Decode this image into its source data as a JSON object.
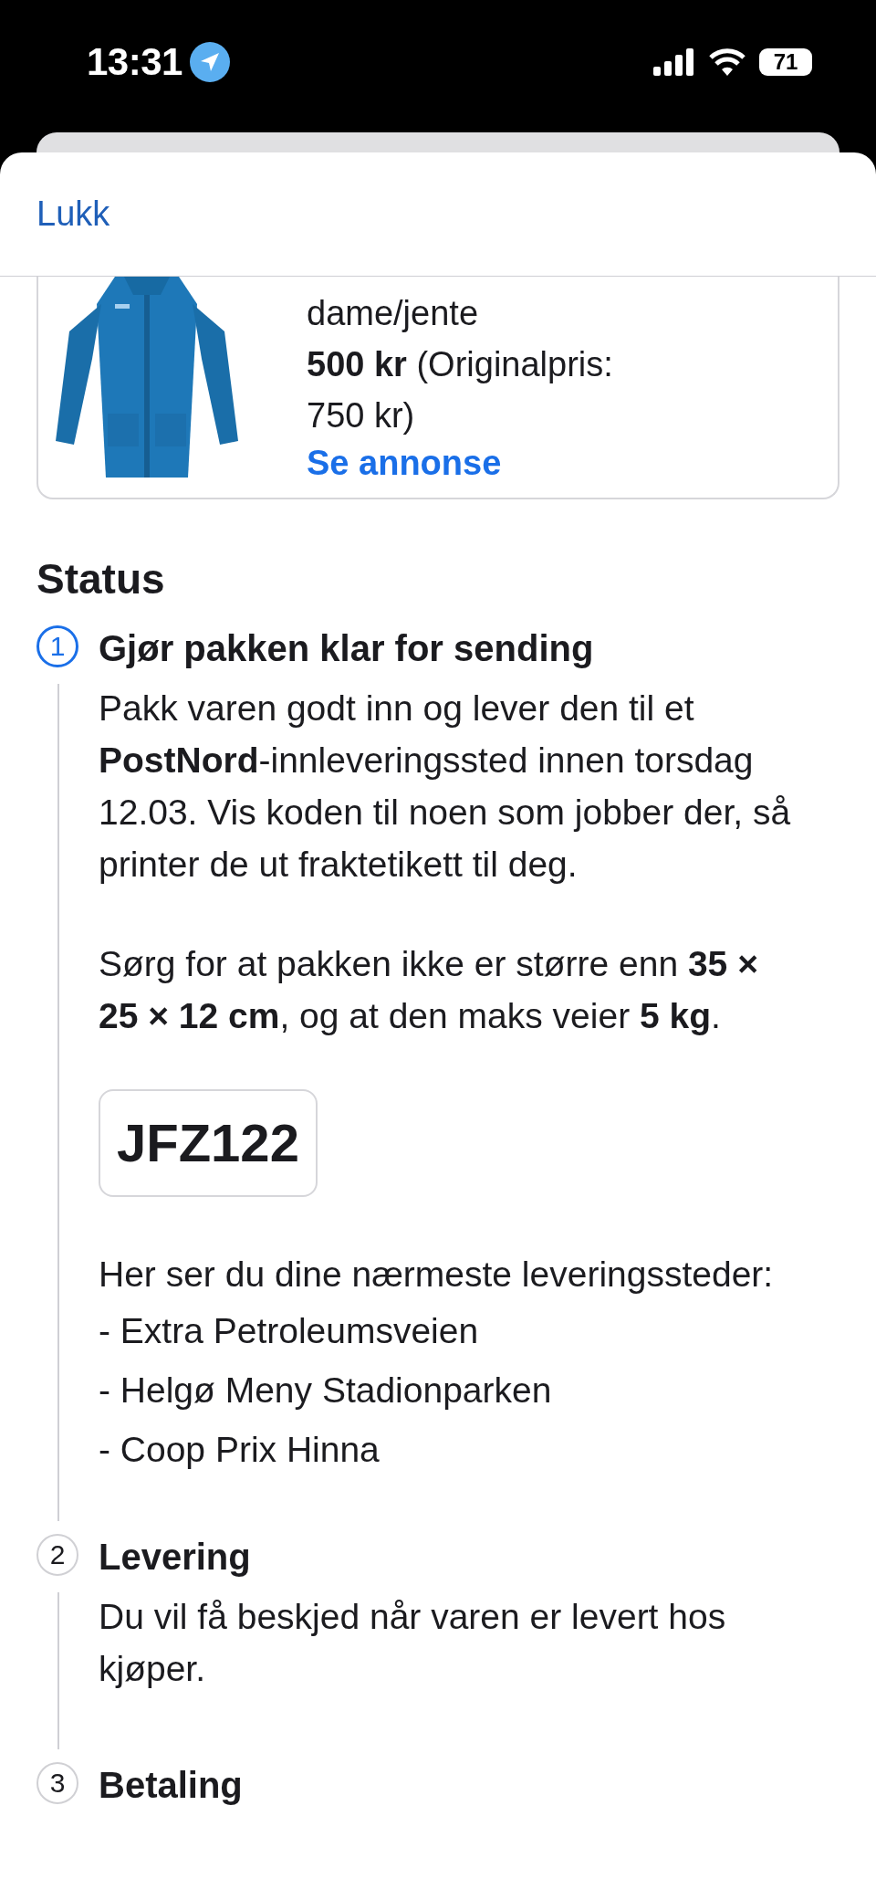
{
  "status_bar": {
    "time": "13:31",
    "battery": "71"
  },
  "sheet": {
    "close_label": "Lukk"
  },
  "product": {
    "title": "dame/jente",
    "price": "500 kr",
    "original_price": "(Originalpris: 750 kr)",
    "link": "Se annonse"
  },
  "status": {
    "heading": "Status",
    "steps": [
      {
        "number": "1",
        "title": "Gjør pakken klar for sending",
        "active": true,
        "blocks": [
          {
            "kind": "paragraph",
            "text": "Pakk varen godt inn og lever den til et **PostNord**-innleveringssted innen torsdag 12.03. Vis koden til noen som jobber der, så printer de ut fraktetikett til deg."
          },
          {
            "kind": "paragraph",
            "text": "Sørg for at pakken ikke er større enn **35 × 25 × 12 cm**, og at den maks veier **5 kg**."
          },
          {
            "kind": "code",
            "text": "JFZ122"
          },
          {
            "kind": "lines",
            "lines": [
              "Her ser du dine nærmeste leveringssteder:",
              "- Extra Petroleumsveien",
              "- Helgø Meny Stadionparken",
              "- Coop Prix Hinna"
            ]
          }
        ]
      },
      {
        "number": "2",
        "title": "Levering",
        "active": false,
        "blocks": [
          {
            "kind": "paragraph",
            "text": "Du vil få beskjed når varen er levert hos kjøper."
          }
        ]
      },
      {
        "number": "3",
        "title": "Betaling",
        "active": false
      }
    ]
  }
}
